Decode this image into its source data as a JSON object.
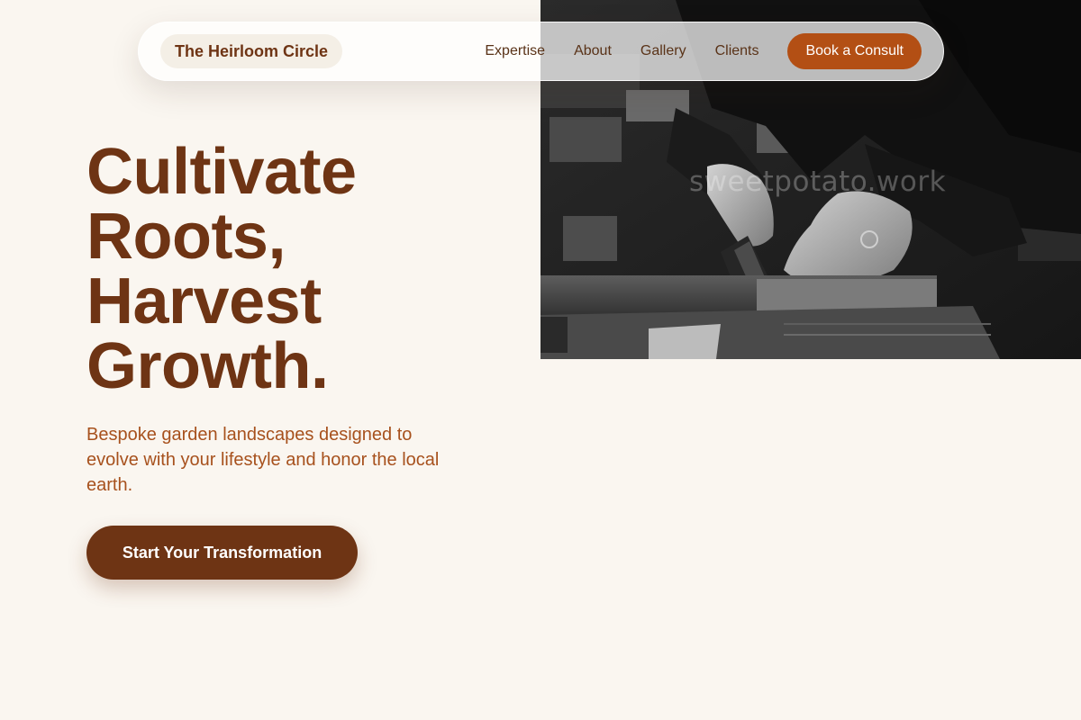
{
  "navbar": {
    "brand": "The Heirloom Circle",
    "links": [
      {
        "label": "Expertise"
      },
      {
        "label": "About"
      },
      {
        "label": "Gallery"
      },
      {
        "label": "Clients"
      }
    ],
    "cta_label": "Book a Consult"
  },
  "hero": {
    "headline_lines": [
      "Cultivate",
      "Roots,",
      "Harvest",
      "Growth."
    ],
    "subtext": "Bespoke garden landscapes designed to evolve with your lifestyle and honor the local earth.",
    "cta_label": "Start Your Transformation",
    "image": {
      "description_icon": "craftsman-sawing-wood-photo",
      "watermark": "sweetpotato.work"
    }
  },
  "colors": {
    "background": "#faf6f0",
    "brand_brown": "#6e3414",
    "accent_orange": "#b34f14",
    "subtext_orange": "#a7511d",
    "nav_text": "#5a3318"
  }
}
